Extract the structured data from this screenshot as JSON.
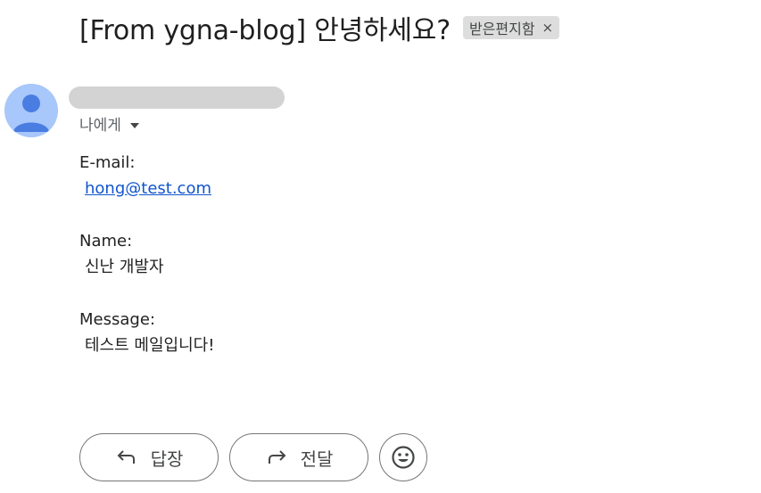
{
  "message": {
    "subject": "[From ygna-blog] 안녕하세요?",
    "label": "받은편지함",
    "label_remove_glyph": "×",
    "recipient": "나에게"
  },
  "body": {
    "fields": [
      {
        "label": "E-mail:",
        "value": "hong@test.com"
      },
      {
        "label": "Name:",
        "value": "신난 개발자"
      },
      {
        "label": "Message:",
        "value": "테스트 메일입니다!"
      }
    ]
  },
  "actions": {
    "reply_label": "답장",
    "forward_label": "전달"
  },
  "icons": {
    "avatar": "person-avatar-icon",
    "reply": "reply-arrow-icon",
    "forward": "forward-arrow-icon",
    "emoji": "smiley-face-icon",
    "recipient_dropdown": "caret-down-icon"
  },
  "colors": {
    "avatar_bg": "#a8c7fa",
    "avatar_fg": "#4a7de2",
    "link": "#1155cc",
    "label_chip_bg": "#dddddd"
  }
}
